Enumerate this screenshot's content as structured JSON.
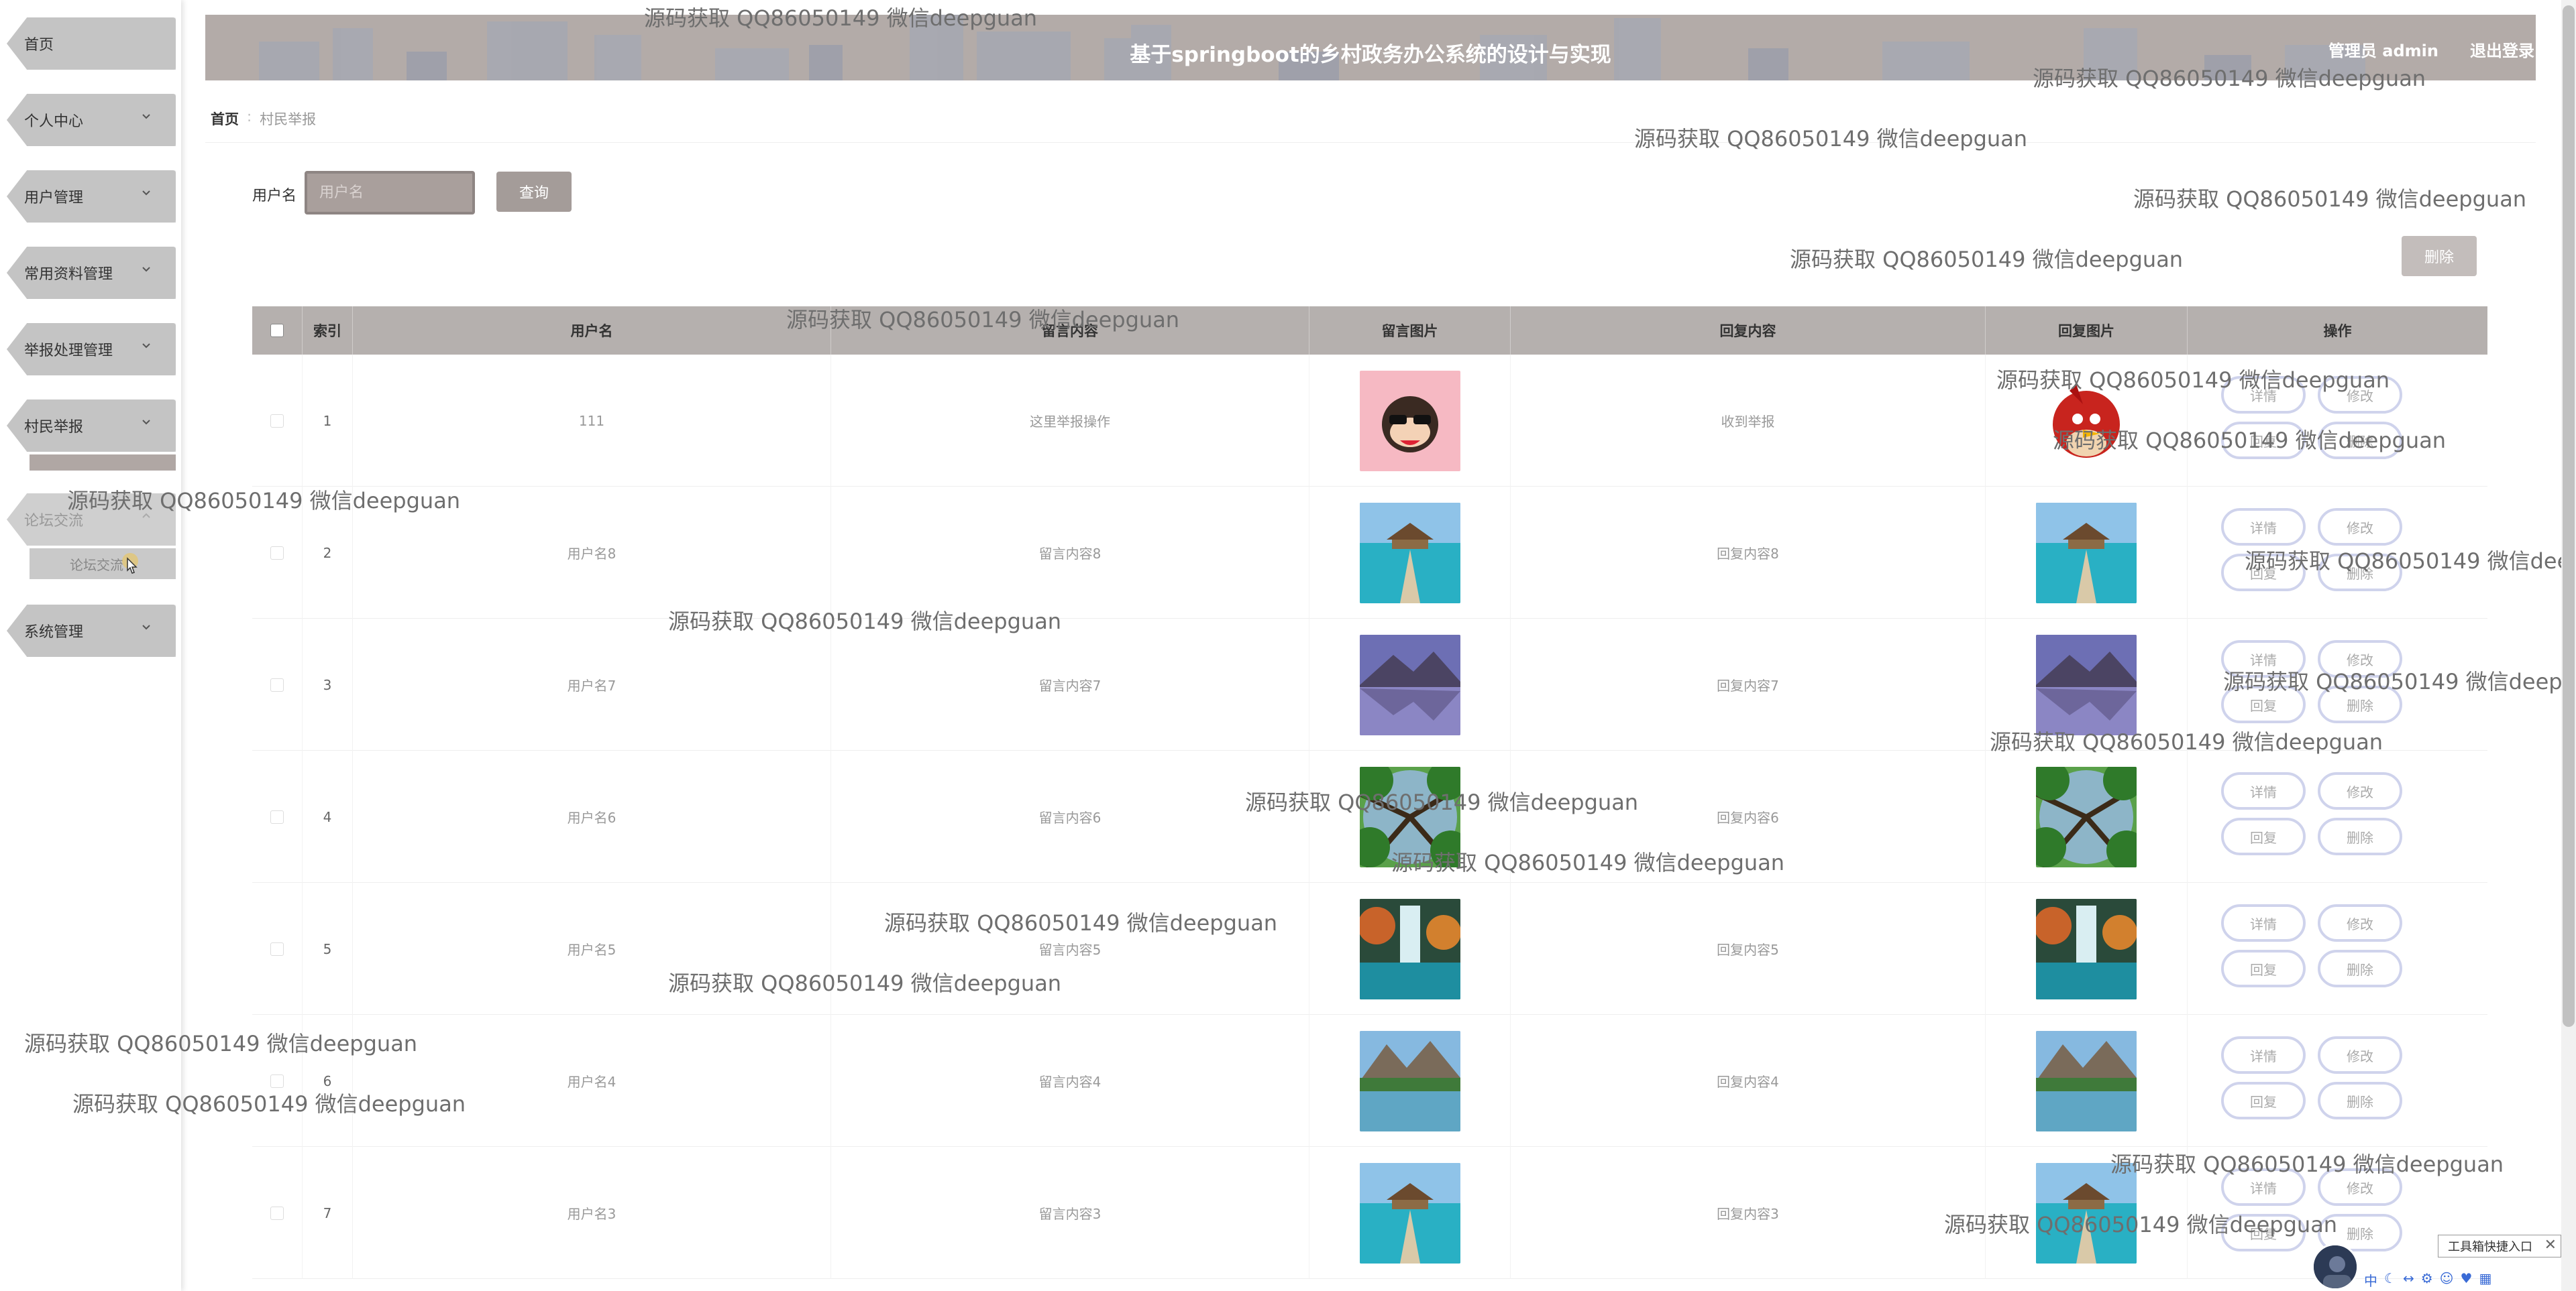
{
  "header": {
    "title": "基于springboot的乡村政务办公系统的设计与实现",
    "user": "管理员 admin",
    "logout": "退出登录"
  },
  "sidebar": {
    "items": [
      {
        "label": "首页"
      },
      {
        "label": "个人中心"
      },
      {
        "label": "用户管理"
      },
      {
        "label": "常用资料管理"
      },
      {
        "label": "举报处理管理"
      },
      {
        "label": "村民举报"
      },
      {
        "label": "论坛交流"
      },
      {
        "label": "系统管理"
      }
    ],
    "sub_item": "论坛交流"
  },
  "breadcrumb": {
    "home": "首页",
    "current": "村民举报"
  },
  "search": {
    "label": "用户名",
    "placeholder": "用户名",
    "button": "查询"
  },
  "toolbar": {
    "delete": "删除"
  },
  "table": {
    "headers": [
      "索引",
      "用户名",
      "留言内容",
      "留言图片",
      "回复内容",
      "回复图片",
      "操作"
    ],
    "actions": [
      "详情",
      "修改",
      "回复",
      "删除"
    ],
    "rows": [
      {
        "index": "1",
        "username": "111",
        "content": "这里举报操作",
        "reply": "收到举报",
        "img": "monkey",
        "reply_img": "bird"
      },
      {
        "index": "2",
        "username": "用户名8",
        "content": "留言内容8",
        "reply": "回复内容8",
        "img": "pier",
        "reply_img": "pier"
      },
      {
        "index": "3",
        "username": "用户名7",
        "content": "留言内容7",
        "reply": "回复内容7",
        "img": "lake",
        "reply_img": "lake"
      },
      {
        "index": "4",
        "username": "用户名6",
        "content": "留言内容6",
        "reply": "回复内容6",
        "img": "forest",
        "reply_img": "forest"
      },
      {
        "index": "5",
        "username": "用户名5",
        "content": "留言内容5",
        "reply": "回复内容5",
        "img": "waterfall",
        "reply_img": "waterfall"
      },
      {
        "index": "6",
        "username": "用户名4",
        "content": "留言内容4",
        "reply": "回复内容4",
        "img": "mountain",
        "reply_img": "mountain"
      },
      {
        "index": "7",
        "username": "用户名3",
        "content": "留言内容3",
        "reply": "回复内容3",
        "img": "pier",
        "reply_img": "pier"
      }
    ]
  },
  "watermark": "源码获取 QQ86050149 微信deepguan",
  "tool_widget": {
    "label": "工具箱快捷入口",
    "close": "✕"
  }
}
